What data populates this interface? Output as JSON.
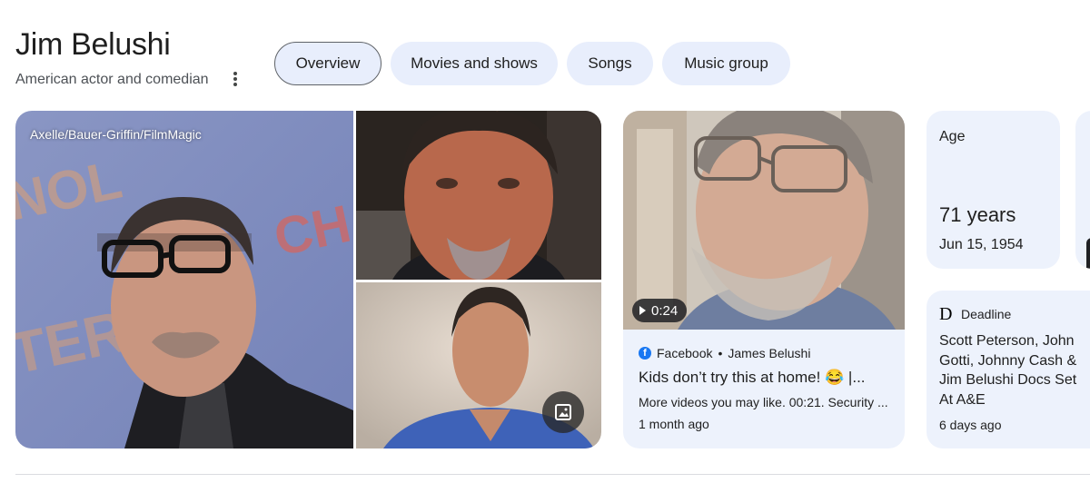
{
  "entity": {
    "name": "Jim Belushi",
    "description": "American actor and comedian"
  },
  "tabs": [
    {
      "label": "Overview",
      "active": true
    },
    {
      "label": "Movies and shows",
      "active": false
    },
    {
      "label": "Songs",
      "active": false
    },
    {
      "label": "Music group",
      "active": false
    }
  ],
  "images": {
    "main_credit": "Axelle/Bauer-Griffin/FilmMagic",
    "more_images_icon": "image-icon"
  },
  "video": {
    "duration": "0:24",
    "source": "Facebook",
    "separator": "•",
    "author": "James Belushi",
    "title": "Kids don’t try this at home! 😂 |...",
    "description": "More videos you may like. 00:21. Security ...",
    "time": "1 month ago"
  },
  "age": {
    "label": "Age",
    "value": "71 years",
    "birthdate": "Jun 15, 1954"
  },
  "news": {
    "source_logo": "D",
    "source": "Deadline",
    "title": "Scott Peterson, John Gotti, Johnny Cash & Jim Belushi Docs Set At A&E",
    "time": "6 days ago"
  },
  "colors": {
    "chip_bg": "#e8eefc",
    "card_bg": "#edf2fc",
    "facebook": "#1877f2"
  }
}
